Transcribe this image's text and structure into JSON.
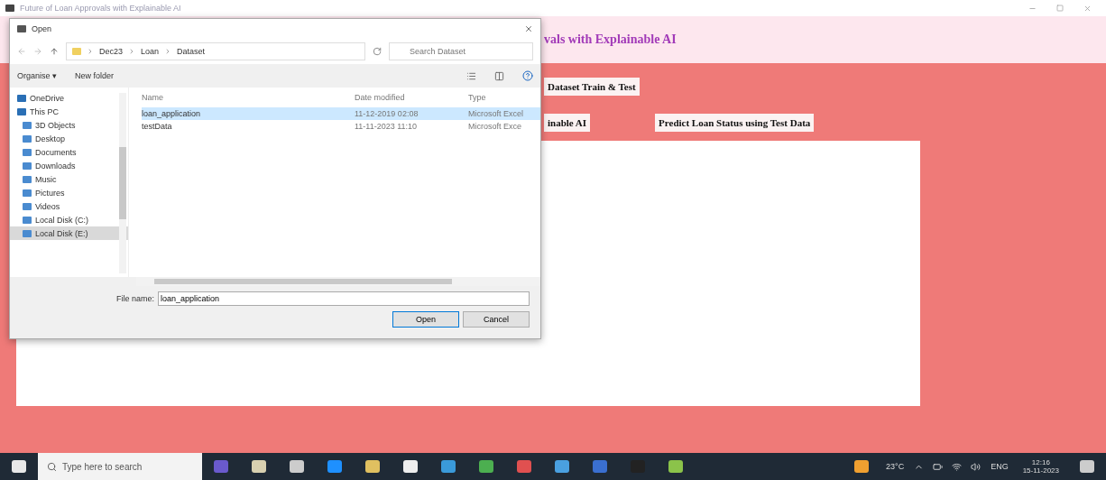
{
  "window": {
    "title": "Future of Loan Approvals with Explainable AI"
  },
  "app": {
    "heading": "vals with Explainable AI",
    "buttons": [
      {
        "label": "Dataset Train & Test"
      },
      {
        "label": "inable AI"
      },
      {
        "label": "Predict Loan Status using Test Data"
      }
    ]
  },
  "dialog": {
    "title": "Open",
    "breadcrumb": [
      "Dec23",
      "Loan",
      "Dataset"
    ],
    "search": {
      "placeholder": "Search Dataset"
    },
    "toolbar": [
      "Organise ▾",
      "New folder"
    ],
    "sidebar": [
      {
        "label": "OneDrive",
        "selected": false
      },
      {
        "label": "This PC",
        "selected": false,
        "children": [
          {
            "label": "3D Objects",
            "selected": false
          },
          {
            "label": "Desktop",
            "selected": false
          },
          {
            "label": "Documents",
            "selected": false
          },
          {
            "label": "Downloads",
            "selected": false
          },
          {
            "label": "Music",
            "selected": false
          },
          {
            "label": "Pictures",
            "selected": false
          },
          {
            "label": "Videos",
            "selected": false
          },
          {
            "label": "Local Disk (C:)",
            "selected": false
          },
          {
            "label": "Local Disk (E:)",
            "selected": true
          }
        ]
      }
    ],
    "columns": [
      "Name",
      "Date modified",
      "Type"
    ],
    "files": [
      {
        "name": "loan_application",
        "date": "11-12-2019 02:08",
        "type": "Microsoft Excel",
        "selected": true
      },
      {
        "name": "testData",
        "date": "11-11-2023 11:10",
        "type": "Microsoft Exce",
        "selected": false
      }
    ],
    "file_name": {
      "label": "File name:",
      "value": "loan_application"
    },
    "buttons": [
      "Open",
      "Cancel"
    ]
  },
  "taskbar": {
    "search": {
      "placeholder": "Type here to search"
    },
    "weather": "23°C",
    "language": "ENG",
    "time": "12:16",
    "date": "15-11-2023"
  }
}
